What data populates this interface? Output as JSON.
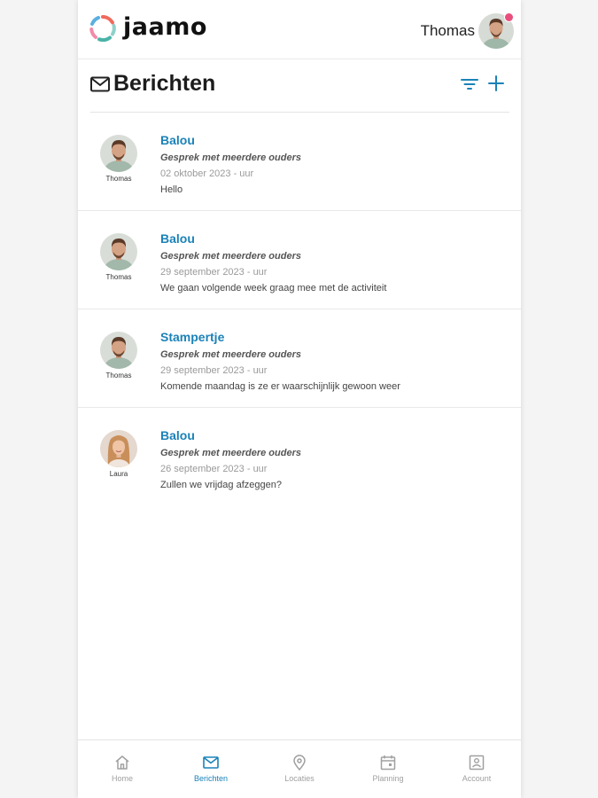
{
  "app": {
    "brand": "jaamo",
    "user_name": "Thomas",
    "accent_color": "#1b82b8",
    "notification_dot_color": "#e94f7c"
  },
  "header": {
    "title": "Berichten",
    "icon": "mail-icon",
    "actions": [
      "filter-icon",
      "plus-icon"
    ]
  },
  "messages": [
    {
      "sender": "Balou",
      "subject": "Gesprek met meerdere ouders",
      "date": "02 oktober 2023 - uur",
      "preview": "Hello",
      "avatar_name": "Thomas"
    },
    {
      "sender": "Balou",
      "subject": "Gesprek met meerdere ouders",
      "date": "29 september 2023 - uur",
      "preview": "We gaan volgende week graag mee met de activiteit",
      "avatar_name": "Thomas"
    },
    {
      "sender": "Stampertje",
      "subject": "Gesprek met meerdere ouders",
      "date": "29 september 2023 - uur",
      "preview": "Komende maandag is ze er waarschijnlijk gewoon weer",
      "avatar_name": "Thomas"
    },
    {
      "sender": "Balou",
      "subject": "Gesprek met meerdere ouders",
      "date": "26 september 2023 - uur",
      "preview": "Zullen we vrijdag afzeggen?",
      "avatar_name": "Laura"
    }
  ],
  "nav": [
    {
      "label": "Home",
      "icon": "home-icon",
      "active": false
    },
    {
      "label": "Berichten",
      "icon": "mail-icon",
      "active": true
    },
    {
      "label": "Locaties",
      "icon": "location-pin-icon",
      "active": false
    },
    {
      "label": "Planning",
      "icon": "calendar-icon",
      "active": false
    },
    {
      "label": "Account",
      "icon": "account-icon",
      "active": false
    }
  ]
}
